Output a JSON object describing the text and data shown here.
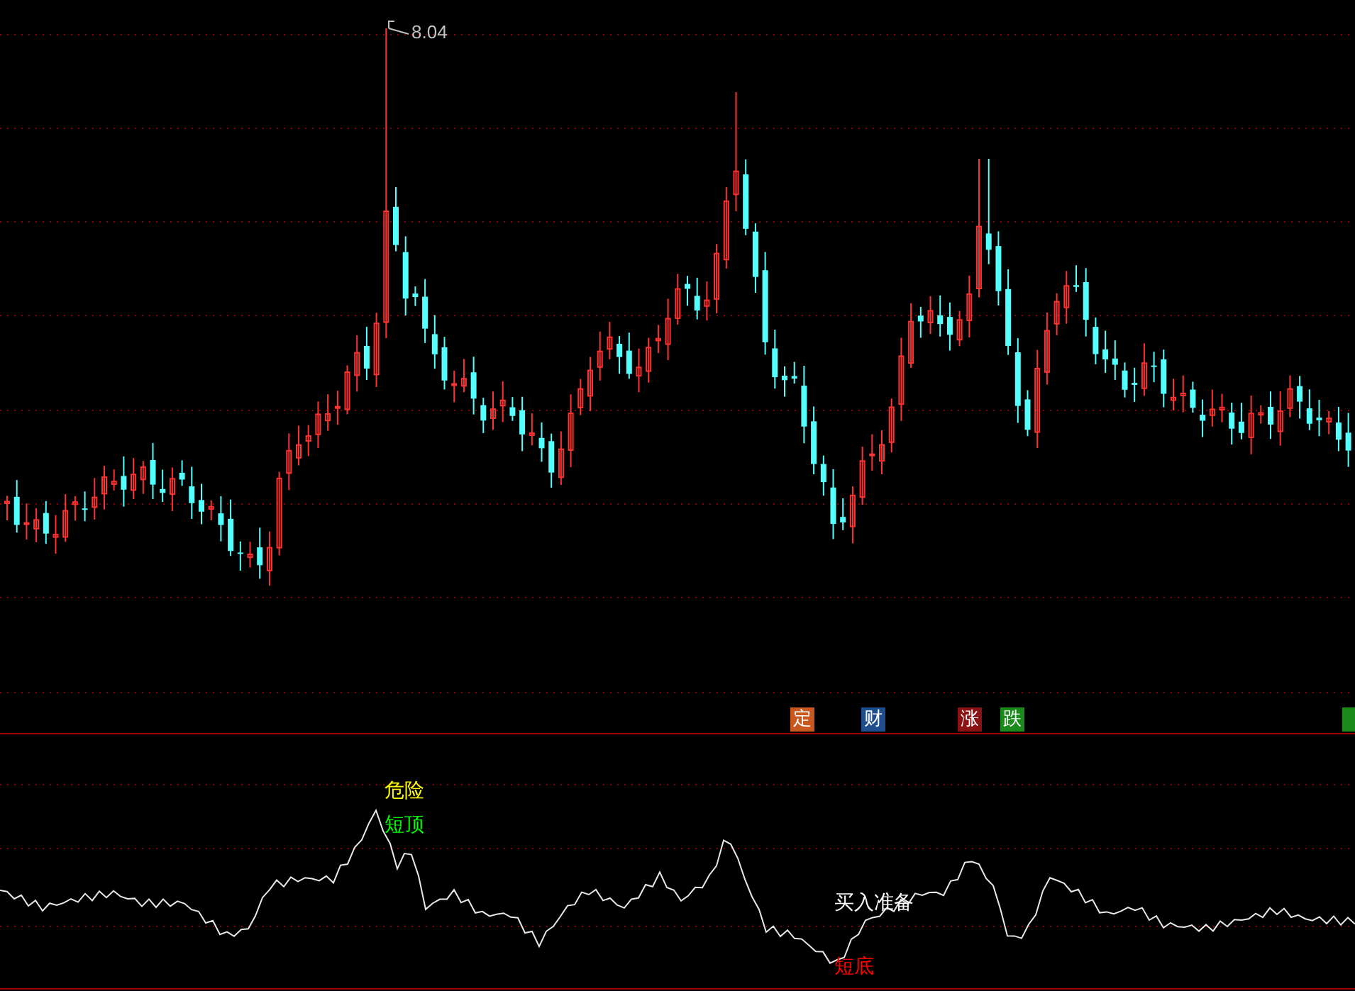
{
  "price_panel": {
    "high_label": "8.04"
  },
  "event_markers": [
    {
      "text": "定",
      "color": "#c8581e"
    },
    {
      "text": "财",
      "color": "#1f4e8c"
    },
    {
      "text": "涨",
      "color": "#8b1212"
    },
    {
      "text": "跌",
      "color": "#1a8a1a"
    },
    {
      "color": "#1a8a1a"
    }
  ],
  "indicator_panel": {
    "labels": [
      {
        "text": "危险",
        "kind": "warning"
      },
      {
        "text": "短顶",
        "kind": "top"
      },
      {
        "text": "买入准备",
        "kind": "prepare"
      },
      {
        "text": "短底",
        "kind": "bottom"
      }
    ]
  }
}
